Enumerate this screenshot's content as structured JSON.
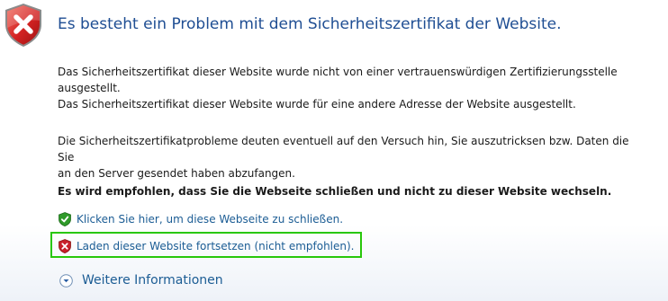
{
  "header": {
    "title": "Es besteht ein Problem mit dem Sicherheitszertifikat der Website."
  },
  "body": {
    "paragraph1_line1": "Das Sicherheitszertifikat dieser Website wurde nicht von einer vertrauenswürdigen Zertifizierungsstelle",
    "paragraph1_line2": "ausgestellt.",
    "paragraph1_line3": "Das Sicherheitszertifikat dieser Website wurde für eine andere Adresse der Website ausgestellt.",
    "paragraph2_line1": "Die Sicherheitszertifikatprobleme deuten eventuell auf den Versuch hin, Sie auszutricksen bzw. Daten die Sie",
    "paragraph2_line2": "an den Server gesendet haben abzufangen.",
    "recommendation": "Es wird empfohlen, dass Sie die Webseite schließen und nicht zu dieser Website wechseln."
  },
  "links": {
    "close_label": "Klicken Sie hier, um diese Webseite zu schließen.",
    "continue_label": "Laden dieser Website fortsetzen (nicht empfohlen).",
    "more_info_label": "Weitere Informationen"
  },
  "icons": {
    "main": "red-shield-x-icon",
    "close": "green-shield-check-icon",
    "continue": "red-shield-x-icon",
    "more_info": "chevron-down-circle-icon"
  },
  "colors": {
    "heading": "#1f4e93",
    "link": "#1b5c94",
    "danger": "#c8202a",
    "safe": "#2f9a2a",
    "focus": "#28c70a"
  }
}
